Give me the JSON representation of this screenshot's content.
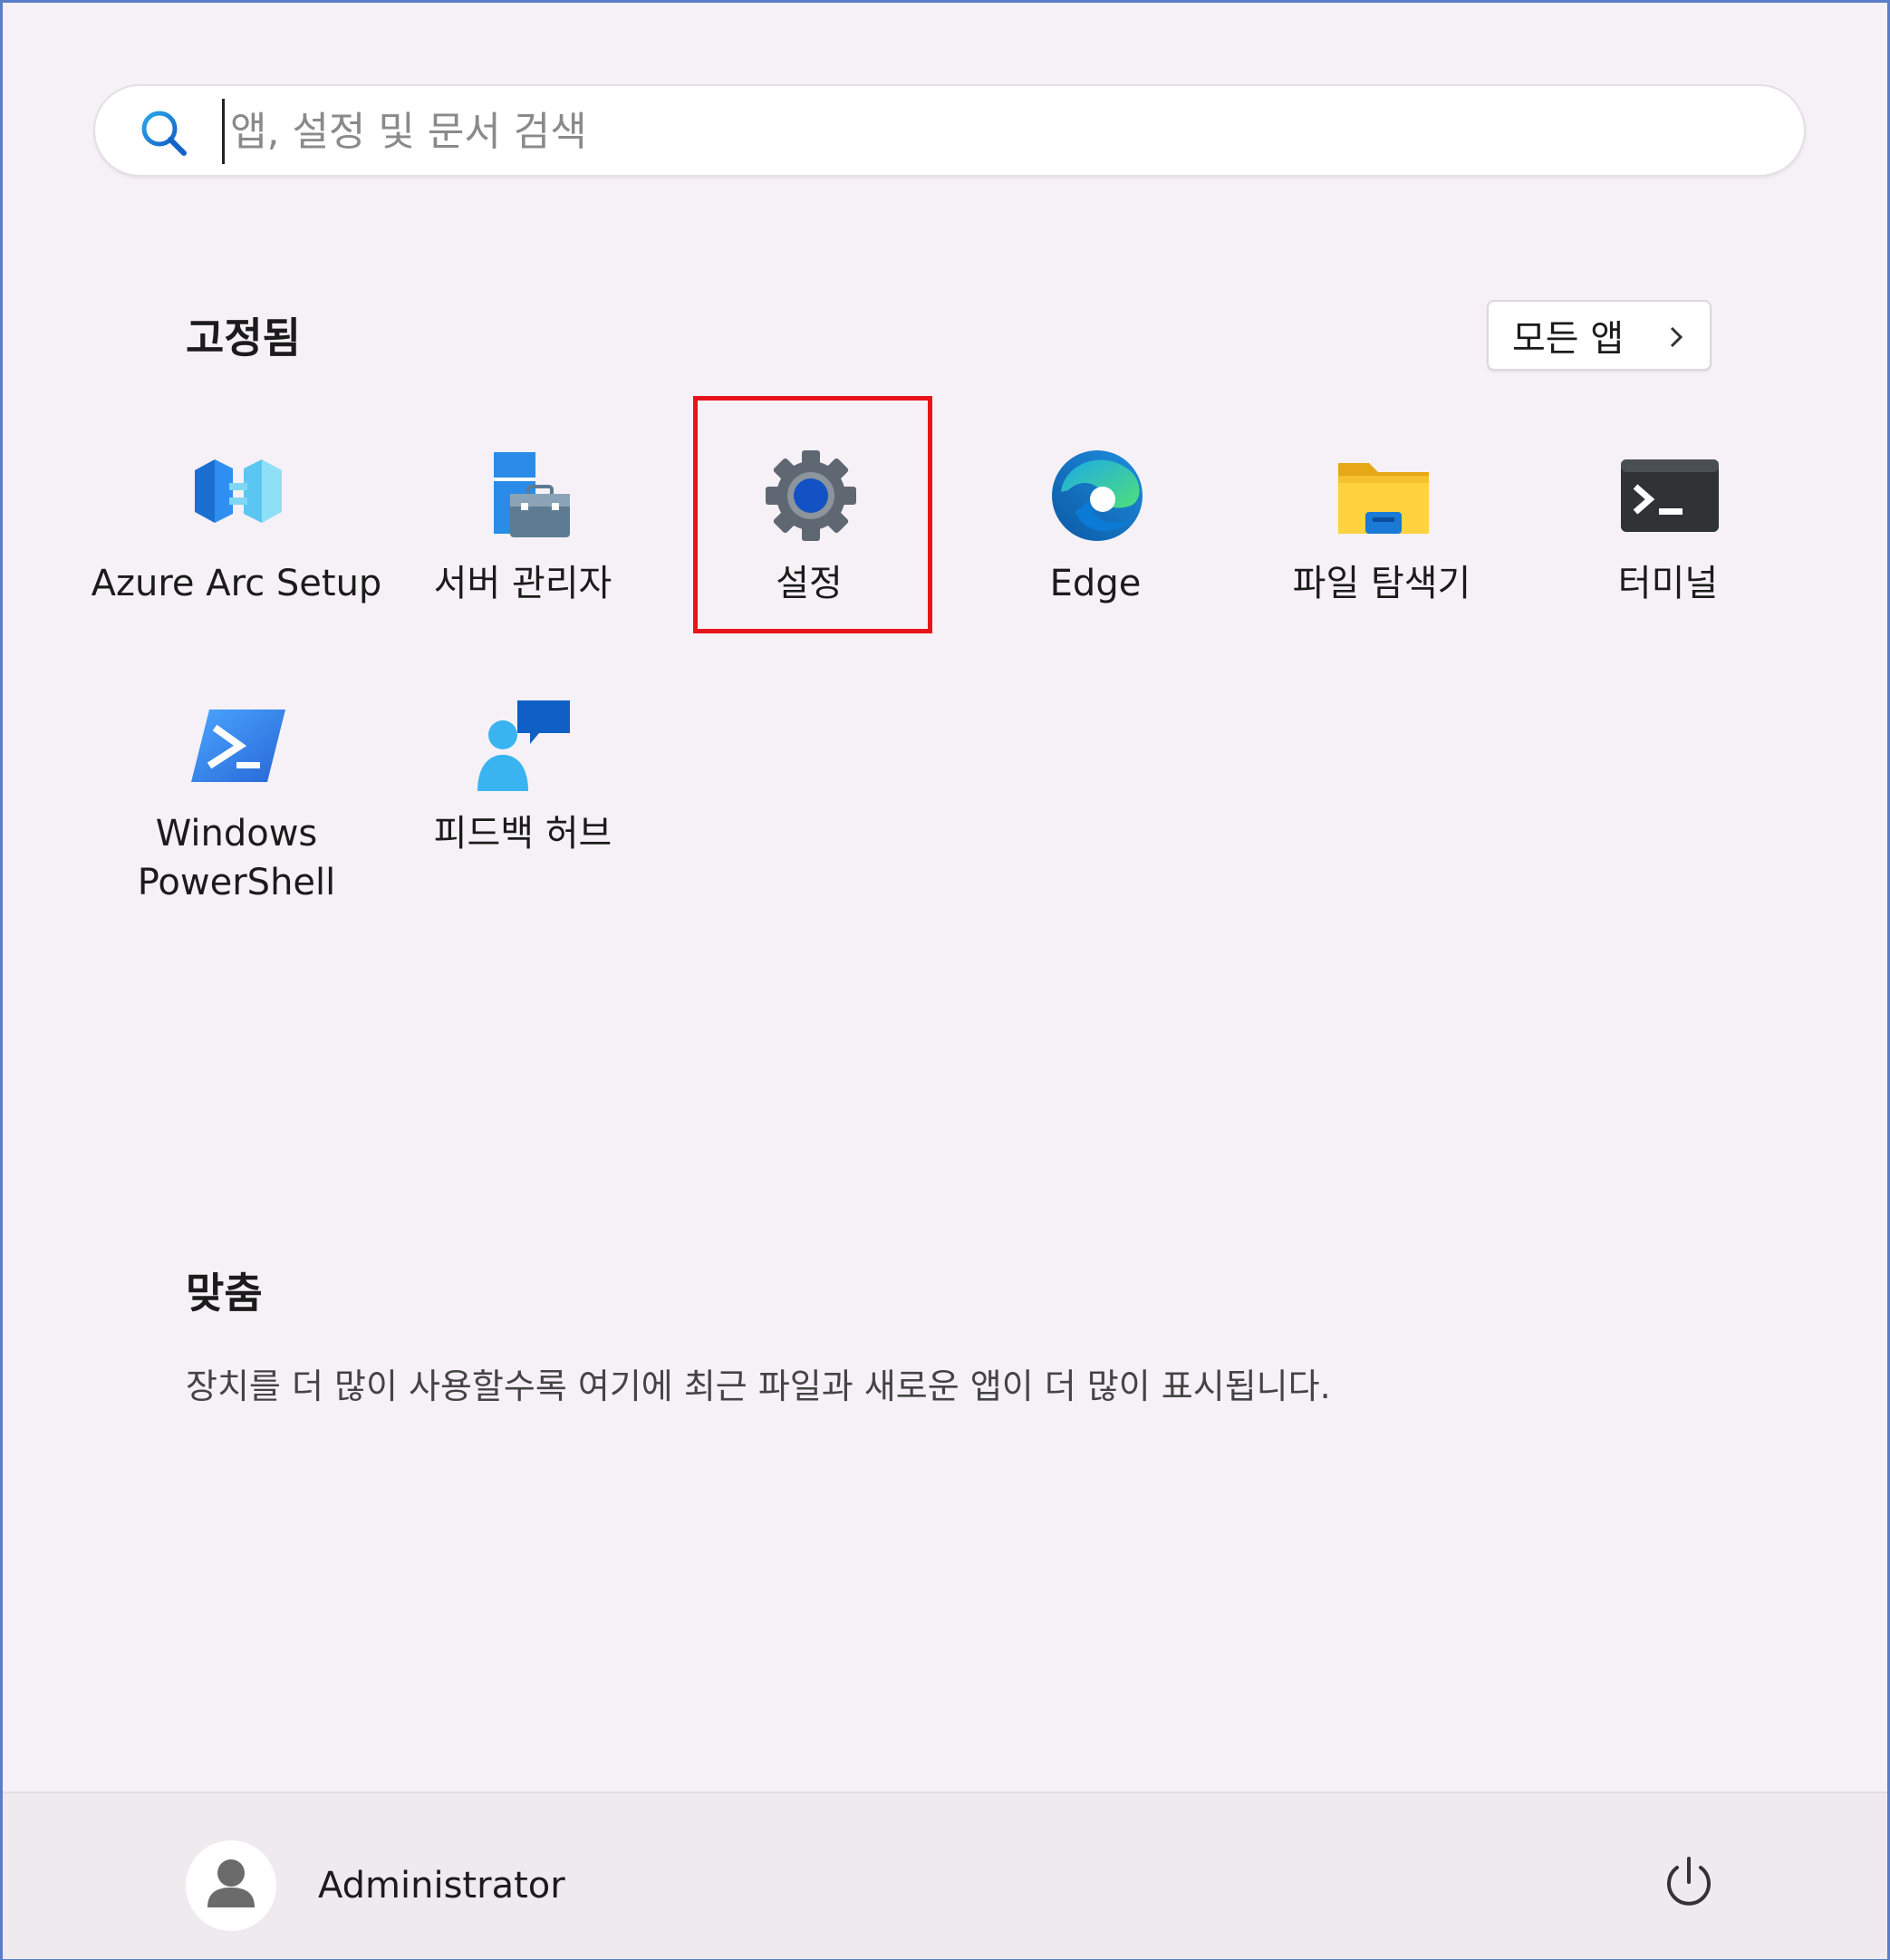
{
  "search": {
    "placeholder": "앱, 설정 및 문서 검색"
  },
  "pinned": {
    "heading": "고정됨",
    "all_apps_label": "모든 앱",
    "apps": [
      {
        "label": "Azure Arc Setup",
        "icon": "azure-arc-icon"
      },
      {
        "label": "서버 관리자",
        "icon": "server-manager-icon"
      },
      {
        "label": "설정",
        "icon": "settings-gear-icon"
      },
      {
        "label": "Edge",
        "icon": "edge-icon"
      },
      {
        "label": "파일 탐색기",
        "icon": "folder-icon"
      },
      {
        "label": "터미널",
        "icon": "terminal-icon"
      },
      {
        "label_line1": "Windows",
        "label_line2": "PowerShell",
        "icon": "powershell-icon"
      },
      {
        "label": "피드백 허브",
        "icon": "feedback-hub-icon"
      }
    ]
  },
  "recommended": {
    "heading": "맞춤",
    "text": "장치를 더 많이 사용할수록 여기에 최근 파일과 새로운 앱이 더 많이 표시됩니다."
  },
  "footer": {
    "user_name": "Administrator"
  },
  "colors": {
    "background": "#f6f1f6",
    "highlight": "#e8141c",
    "frame": "#5a7ec8",
    "footer": "#eeeaee"
  }
}
